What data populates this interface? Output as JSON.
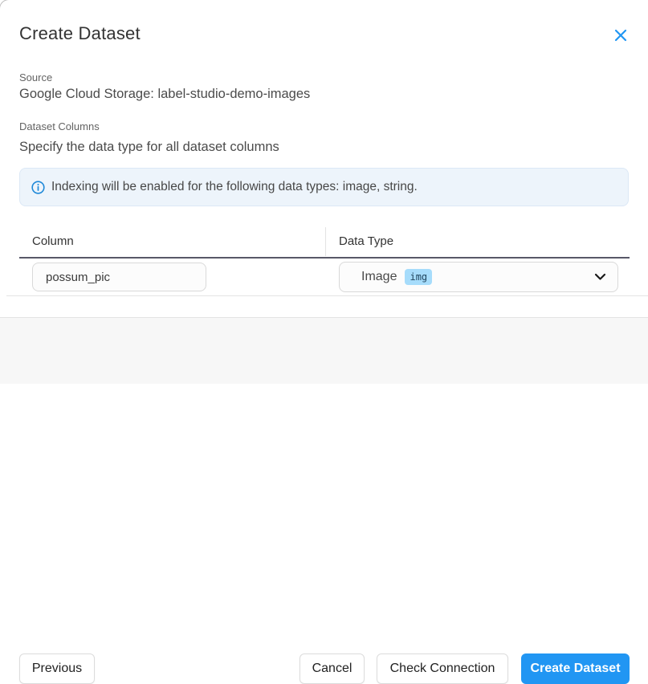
{
  "dialog": {
    "title": "Create Dataset"
  },
  "source": {
    "label": "Source",
    "value": "Google Cloud Storage: label-studio-demo-images"
  },
  "dataset_columns": {
    "label": "Dataset Columns",
    "description": "Specify the data type for all dataset columns"
  },
  "info_banner": {
    "text": "Indexing will be enabled for the following data types: image, string."
  },
  "table": {
    "headers": [
      "Column",
      "Data Type"
    ],
    "rows": [
      {
        "column_name": "possum_pic",
        "data_type": "Image",
        "data_type_tag": "img"
      }
    ]
  },
  "footer": {
    "previous_label": "Previous",
    "cancel_label": "Cancel",
    "check_connection_label": "Check Connection",
    "create_dataset_label": "Create Dataset"
  },
  "icons": {
    "close": "x-icon",
    "info": "info-circle-icon",
    "chevron": "chevron-down-icon"
  },
  "colors": {
    "accent_blue": "#2196f3",
    "banner_bg": "#edf4fb",
    "tag_bg": "#a6dcfb",
    "footer_bg": "#f7f7f7"
  }
}
